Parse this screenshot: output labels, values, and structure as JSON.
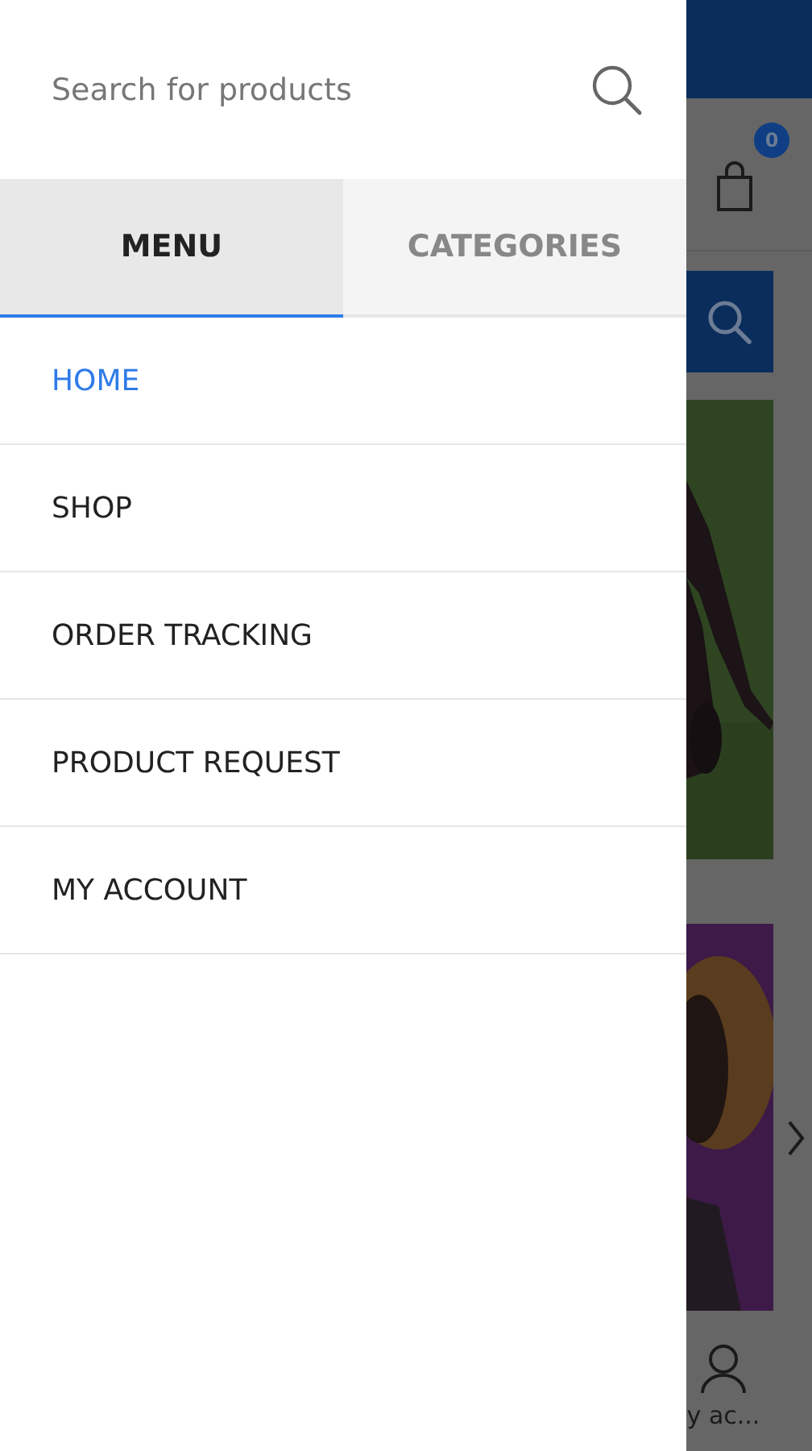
{
  "drawer": {
    "search": {
      "placeholder": "Search for products"
    },
    "tabs": [
      {
        "label": "MENU",
        "selected": true
      },
      {
        "label": "CATEGORIES",
        "selected": false
      }
    ],
    "menu": [
      {
        "label": "HOME",
        "selected": true
      },
      {
        "label": "SHOP",
        "selected": false
      },
      {
        "label": "ORDER TRACKING",
        "selected": false
      },
      {
        "label": "PRODUCT REQUEST",
        "selected": false
      },
      {
        "label": "MY ACCOUNT",
        "selected": false
      }
    ]
  },
  "background_page": {
    "cart_count": "0",
    "account_label": "y ac..."
  }
}
